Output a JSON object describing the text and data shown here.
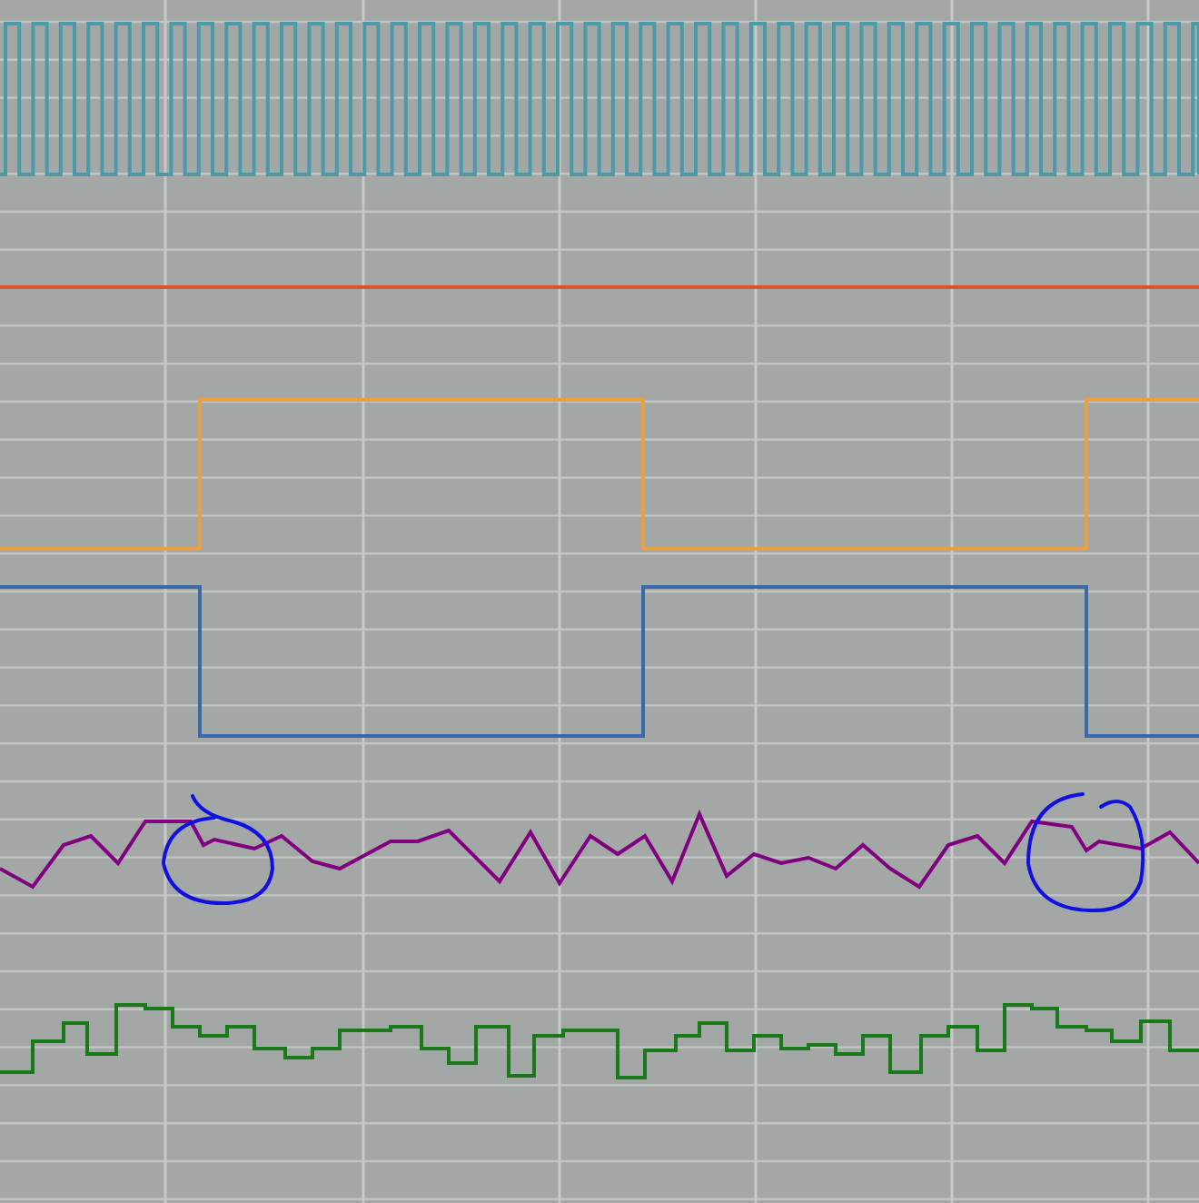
{
  "traces": [
    {
      "kind": "clock",
      "color": "#4b9aa8"
    },
    {
      "kind": "flat",
      "color": "#e0532a"
    },
    {
      "kind": "square",
      "color": "#e8a040"
    },
    {
      "kind": "square-inverted",
      "color": "#3a68a8"
    },
    {
      "kind": "noise",
      "color": "#800080"
    },
    {
      "kind": "steps",
      "color": "#1a7a1a"
    }
  ],
  "annotations": [
    {
      "kind": "loop",
      "color": "#1010e0"
    },
    {
      "kind": "loop",
      "color": "#1010e0"
    }
  ]
}
